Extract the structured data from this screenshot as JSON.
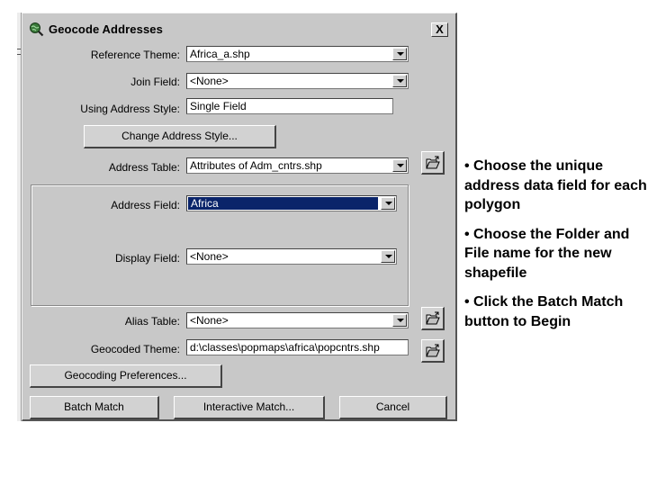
{
  "dialog": {
    "title": "Geocode Addresses",
    "close_label": "X",
    "reference_theme": {
      "label": "Reference Theme:",
      "value": "Africa_a.shp"
    },
    "join_field": {
      "label": "Join Field:",
      "value": "<None>"
    },
    "address_style": {
      "label": "Using Address Style:",
      "value": "Single Field"
    },
    "change_style_button": "Change Address Style...",
    "address_table": {
      "label": "Address Table:",
      "value": "Attributes of Adm_cntrs.shp"
    },
    "address_field": {
      "label": "Address Field:",
      "value": "Africa"
    },
    "display_field": {
      "label": "Display Field:",
      "value": "<None>"
    },
    "alias_table": {
      "label": "Alias Table:",
      "value": "<None>"
    },
    "geocoded_theme": {
      "label": "Geocoded Theme:",
      "value": "d:\\classes\\popmaps\\africa\\popcntrs.shp"
    },
    "preferences_button": "Geocoding Preferences...",
    "batch_match_button": "Batch Match",
    "interactive_match_button": "Interactive Match...",
    "cancel_button": "Cancel"
  },
  "notes": [
    "• Choose the unique address data field for each polygon",
    "• Choose the Folder and File name for the new shapefile",
    "• Click the Batch Match button to Begin"
  ],
  "colors": {
    "dialog_bg": "#c8c8c8",
    "selection": "#0a246a"
  },
  "icons": {
    "title": "globe-search-icon",
    "browse": "open-folder-icon"
  }
}
